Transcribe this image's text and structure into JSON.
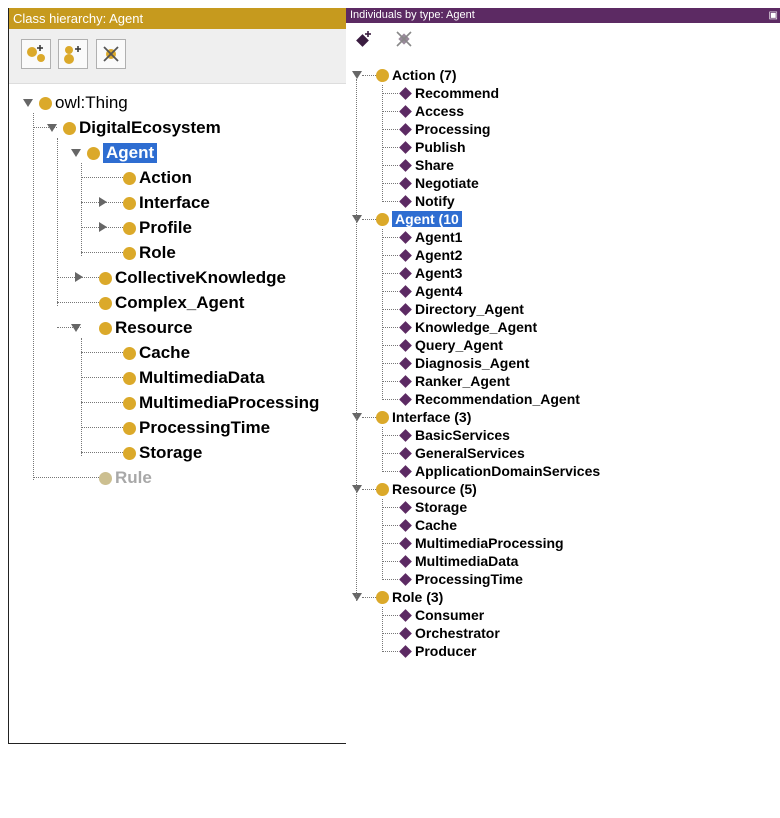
{
  "left_panel": {
    "title": "Class hierarchy: Agent",
    "toolbar": [
      "add-subclass-icon",
      "add-sibling-class-icon",
      "delete-class-icon"
    ],
    "tree": [
      {
        "label": "owl:Thing"
      },
      {
        "label": "DigitalEcosystem"
      },
      {
        "label": "Agent",
        "selected": true
      },
      {
        "label": "Action"
      },
      {
        "label": "Interface"
      },
      {
        "label": "Profile"
      },
      {
        "label": "Role"
      },
      {
        "label": "CollectiveKnowledge"
      },
      {
        "label": "Complex_Agent"
      },
      {
        "label": "Resource"
      },
      {
        "label": "Cache"
      },
      {
        "label": "MultimediaData"
      },
      {
        "label": "MultimediaProcessing"
      },
      {
        "label": "ProcessingTime"
      },
      {
        "label": "Storage"
      },
      {
        "label": "Rule",
        "grayed": true
      }
    ]
  },
  "right_panel": {
    "title": "Individuals by type: Agent",
    "toolbar": [
      "add-individual-icon",
      "delete-individual-icon"
    ],
    "groups": [
      {
        "label": "Action (7)",
        "items": [
          "Recommend",
          "Access",
          "Processing",
          "Publish",
          "Share",
          "Negotiate",
          "Notify"
        ]
      },
      {
        "label": "Agent (10",
        "selected": true,
        "items": [
          "Agent1",
          "Agent2",
          "Agent3",
          "Agent4",
          "Directory_Agent",
          "Knowledge_Agent",
          "Query_Agent",
          "Diagnosis_Agent",
          "Ranker_Agent",
          "Recommendation_Agent"
        ]
      },
      {
        "label": "Interface (3)",
        "items": [
          "BasicServices",
          "GeneralServices",
          "ApplicationDomainServices"
        ]
      },
      {
        "label": "Resource (5)",
        "items": [
          "Storage",
          "Cache",
          "MultimediaProcessing",
          "MultimediaData",
          "ProcessingTime"
        ]
      },
      {
        "label": "Role (3)",
        "items": [
          "Consumer",
          "Orchestrator",
          "Producer"
        ]
      }
    ]
  },
  "colors": {
    "class_title_bar": "#c69a1e",
    "individual_title_bar": "#5c2a63",
    "class_node": "#dba92a",
    "individual_node": "#5c2a63",
    "selection": "#2e6dd1"
  }
}
